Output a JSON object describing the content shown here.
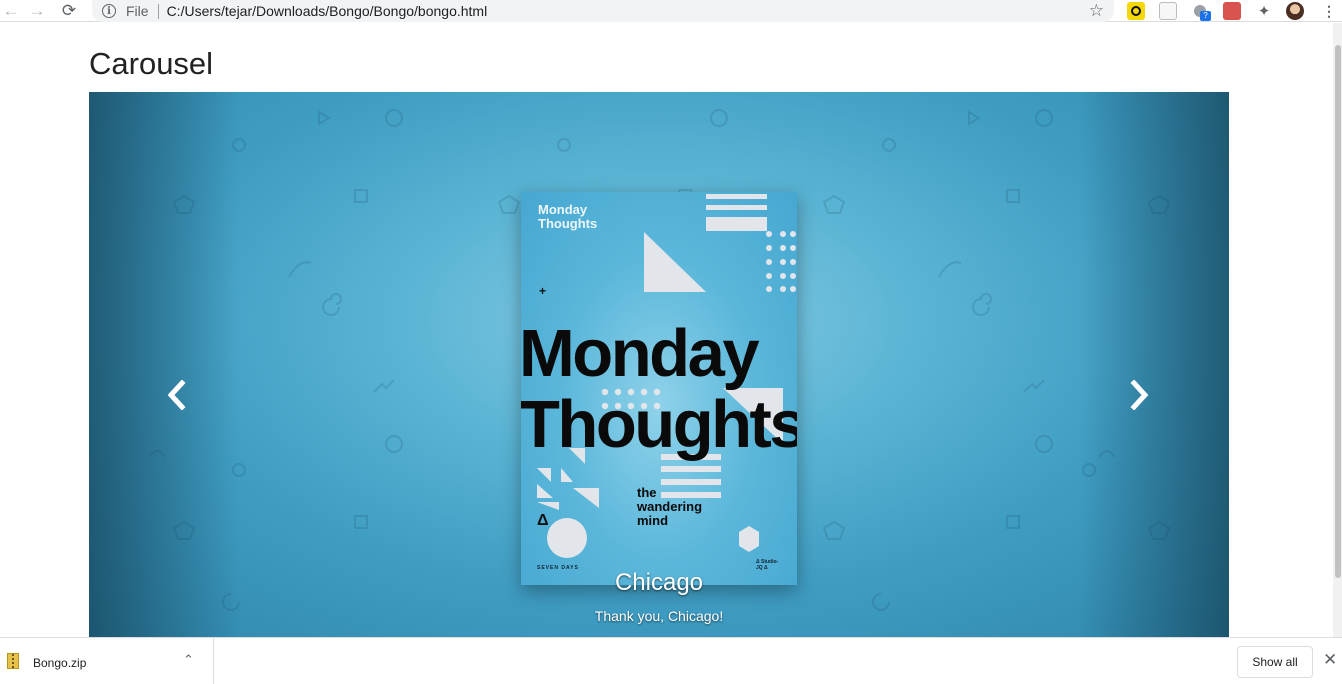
{
  "browser": {
    "scheme_label": "File",
    "url": "C:/Users/tejar/Downloads/Bongo/Bongo/bongo.html",
    "extension_badge": "?"
  },
  "page": {
    "title": "Carousel"
  },
  "carousel": {
    "poster": {
      "small_title_line1": "Monday",
      "small_title_line2": "Thoughts",
      "big_line1": "Monday",
      "big_line2": "Thoughts",
      "sub_line1": "the",
      "sub_line2": "wandering",
      "sub_line3": "mind",
      "footer_left": "SEVEN DAYS",
      "footer_right_line1": "Δ Studio-",
      "footer_right_line2": "JQ Δ"
    },
    "caption": {
      "title": "Chicago",
      "text": "Thank you, Chicago!"
    }
  },
  "downloads": {
    "file_name": "Bongo.zip",
    "show_all_label": "Show all"
  }
}
